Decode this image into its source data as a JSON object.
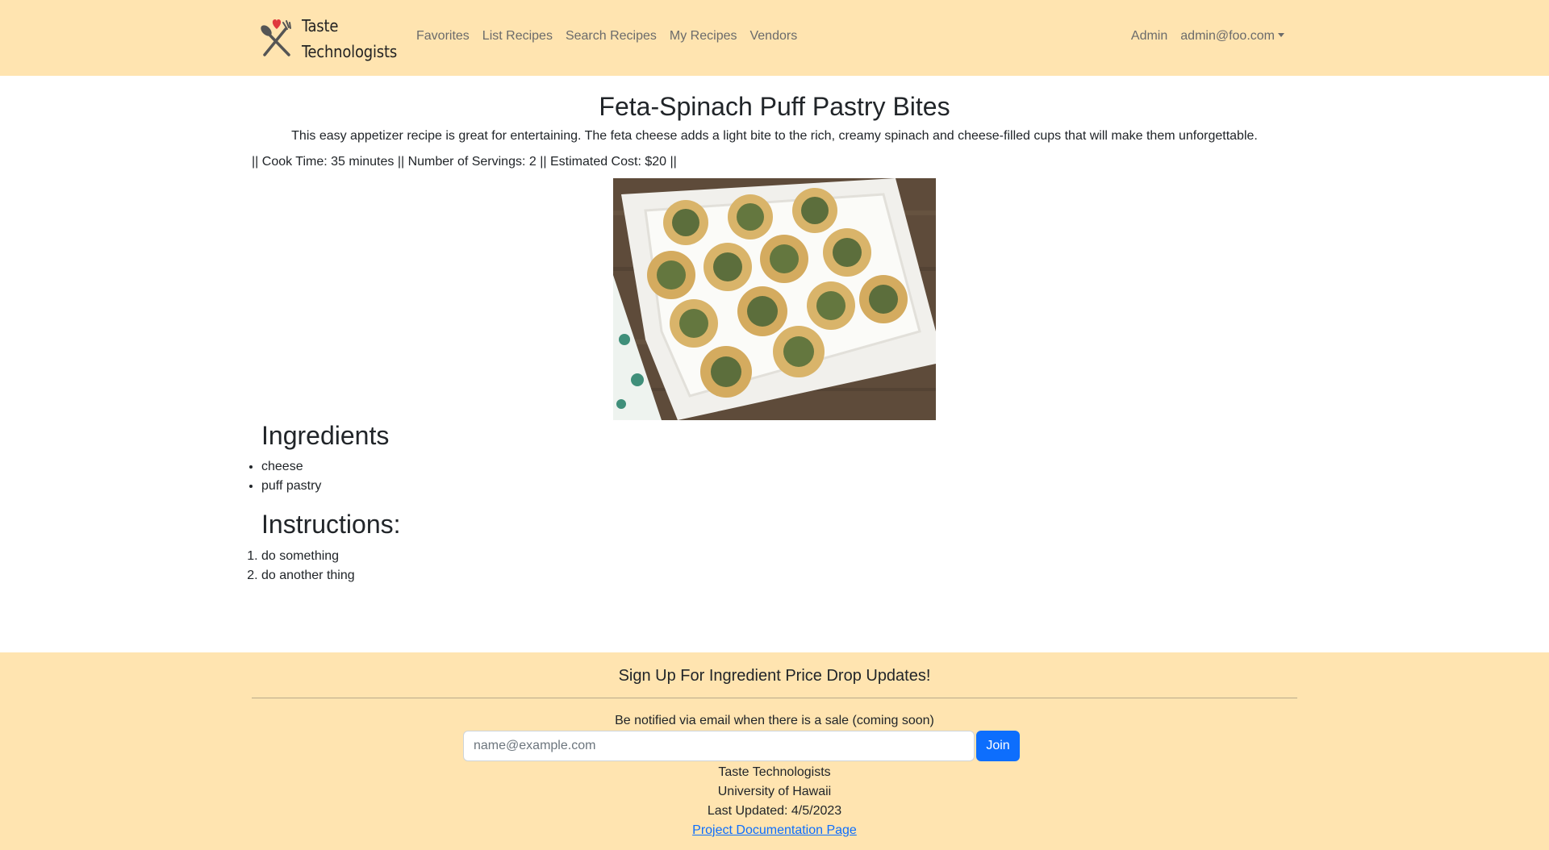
{
  "brand": {
    "line1": "Taste",
    "line2": "Technologists",
    "logo_icon": "fork-spoon-heart-icon",
    "heart_color": "#e0393e"
  },
  "nav": {
    "links": [
      "Favorites",
      "List Recipes",
      "Search Recipes",
      "My Recipes",
      "Vendors"
    ],
    "admin": "Admin",
    "user": "admin@foo.com"
  },
  "recipe": {
    "title": "Feta-Spinach Puff Pastry Bites",
    "description": "This easy appetizer recipe is great for entertaining. The feta cheese adds a light bite to the rich, creamy spinach and cheese-filled cups that will make them unforgettable.",
    "meta": "|| Cook Time: 35 minutes || Number of Servings: 2 || Estimated Cost: $20 ||",
    "ingredients_heading": "Ingredients",
    "ingredients": [
      "cheese",
      "puff pastry"
    ],
    "instructions_heading": "Instructions:",
    "instructions": [
      "do something",
      "do another thing"
    ]
  },
  "footer": {
    "heading": "Sign Up For Ingredient Price Drop Updates!",
    "note": "Be notified via email when there is a sale (coming soon)",
    "email_placeholder": "name@example.com",
    "email_value": "",
    "join_label": "Join",
    "org": "Taste Technologists",
    "university": "University of Hawaii",
    "updated": "Last Updated: 4/5/2023",
    "doc_link": "Project Documentation Page"
  },
  "colors": {
    "navbar_bg": "#ffe4b0",
    "footer_bg": "#ffe4b0",
    "primary": "#0d6efd",
    "link": "#0d6efd"
  }
}
